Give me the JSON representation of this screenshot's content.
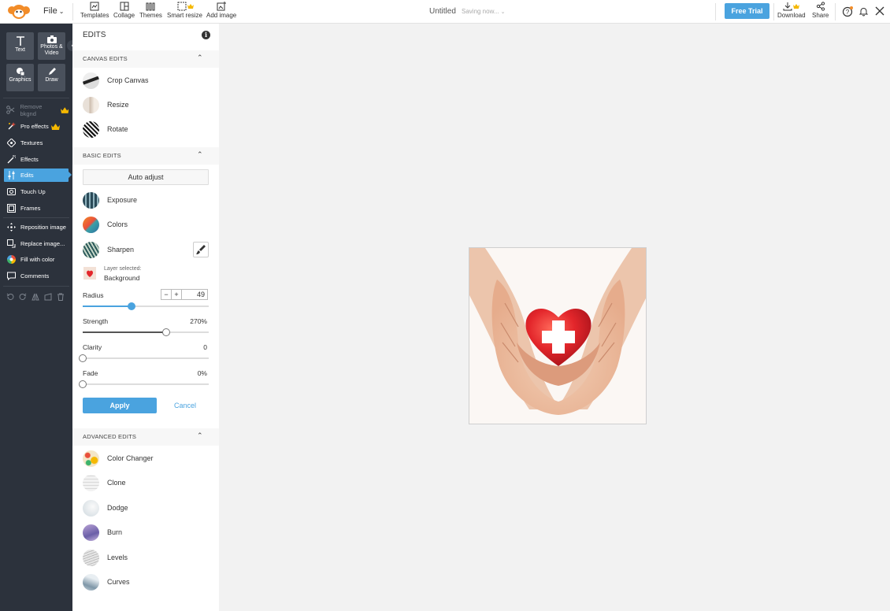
{
  "topbar": {
    "file_label": "File",
    "tools": [
      {
        "label": "Templates",
        "icon": "templates-icon"
      },
      {
        "label": "Collage",
        "icon": "collage-icon"
      },
      {
        "label": "Themes",
        "icon": "themes-icon"
      },
      {
        "label": "Smart resize",
        "icon": "smart-resize-icon"
      },
      {
        "label": "Add image",
        "icon": "add-image-icon"
      }
    ],
    "doc_title": "Untitled",
    "saving_status": "Saving now...",
    "free_trial_label": "Free Trial",
    "download_label": "Download",
    "share_label": "Share"
  },
  "rail": {
    "big_buttons": [
      {
        "label": "Text",
        "icon": "text-icon"
      },
      {
        "label": "Photos & Video",
        "icon": "camera-icon"
      },
      {
        "label": "Graphics",
        "icon": "graphics-icon"
      },
      {
        "label": "Draw",
        "icon": "pencil-icon"
      }
    ],
    "items": [
      {
        "label": "Remove bkgnd",
        "icon": "scissors-icon",
        "premium": true,
        "disabled": true
      },
      {
        "label": "Pro effects",
        "icon": "sparkle-icon",
        "premium": true
      },
      {
        "label": "Textures",
        "icon": "textures-icon"
      },
      {
        "label": "Effects",
        "icon": "wand-icon"
      },
      {
        "label": "Edits",
        "icon": "sliders-icon",
        "active": true
      },
      {
        "label": "Touch Up",
        "icon": "touchup-icon"
      },
      {
        "label": "Frames",
        "icon": "frame-icon"
      },
      {
        "label": "Reposition image",
        "icon": "reposition-icon"
      },
      {
        "label": "Replace image...",
        "icon": "replace-icon"
      },
      {
        "label": "Fill with color",
        "icon": "color-wheel-icon"
      },
      {
        "label": "Comments",
        "icon": "comment-icon"
      }
    ]
  },
  "panel": {
    "title": "EDITS",
    "canvas_edits": {
      "heading": "CANVAS EDITS",
      "items": [
        {
          "label": "Crop Canvas"
        },
        {
          "label": "Resize"
        },
        {
          "label": "Rotate"
        }
      ]
    },
    "basic_edits": {
      "heading": "BASIC EDITS",
      "auto_adjust_label": "Auto adjust",
      "items": [
        {
          "label": "Exposure"
        },
        {
          "label": "Colors"
        },
        {
          "label": "Sharpen"
        }
      ]
    },
    "sharpen": {
      "layer_selected_label": "Layer selected:",
      "layer_name": "Background",
      "radius_label": "Radius",
      "radius_value": "49",
      "radius_fraction": 0.39,
      "minus": "−",
      "plus": "+",
      "strength_label": "Strength",
      "strength_value": "270%",
      "strength_fraction": 0.66,
      "clarity_label": "Clarity",
      "clarity_value": "0",
      "clarity_fraction": 0.0,
      "fade_label": "Fade",
      "fade_value": "0%",
      "fade_fraction": 0.0,
      "apply_label": "Apply",
      "cancel_label": "Cancel"
    },
    "advanced_edits": {
      "heading": "ADVANCED EDITS",
      "items": [
        {
          "label": "Color Changer"
        },
        {
          "label": "Clone"
        },
        {
          "label": "Dodge"
        },
        {
          "label": "Burn"
        },
        {
          "label": "Levels"
        },
        {
          "label": "Curves"
        }
      ]
    }
  },
  "colors": {
    "accent": "#4aa3df",
    "rail_bg": "#2c323c",
    "premium": "#f5b800",
    "heart": "#e3262b"
  }
}
